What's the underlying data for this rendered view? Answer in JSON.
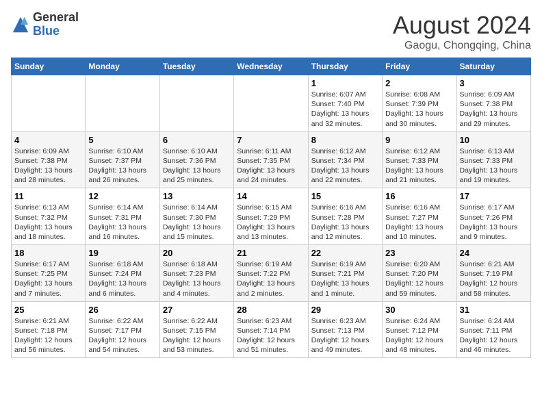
{
  "logo": {
    "general": "General",
    "blue": "Blue"
  },
  "title": {
    "month_year": "August 2024",
    "location": "Gaogu, Chongqing, China"
  },
  "weekdays": [
    "Sunday",
    "Monday",
    "Tuesday",
    "Wednesday",
    "Thursday",
    "Friday",
    "Saturday"
  ],
  "weeks": [
    [
      {
        "day": "",
        "info": ""
      },
      {
        "day": "",
        "info": ""
      },
      {
        "day": "",
        "info": ""
      },
      {
        "day": "",
        "info": ""
      },
      {
        "day": "1",
        "info": "Sunrise: 6:07 AM\nSunset: 7:40 PM\nDaylight: 13 hours\nand 32 minutes."
      },
      {
        "day": "2",
        "info": "Sunrise: 6:08 AM\nSunset: 7:39 PM\nDaylight: 13 hours\nand 30 minutes."
      },
      {
        "day": "3",
        "info": "Sunrise: 6:09 AM\nSunset: 7:38 PM\nDaylight: 13 hours\nand 29 minutes."
      }
    ],
    [
      {
        "day": "4",
        "info": "Sunrise: 6:09 AM\nSunset: 7:38 PM\nDaylight: 13 hours\nand 28 minutes."
      },
      {
        "day": "5",
        "info": "Sunrise: 6:10 AM\nSunset: 7:37 PM\nDaylight: 13 hours\nand 26 minutes."
      },
      {
        "day": "6",
        "info": "Sunrise: 6:10 AM\nSunset: 7:36 PM\nDaylight: 13 hours\nand 25 minutes."
      },
      {
        "day": "7",
        "info": "Sunrise: 6:11 AM\nSunset: 7:35 PM\nDaylight: 13 hours\nand 24 minutes."
      },
      {
        "day": "8",
        "info": "Sunrise: 6:12 AM\nSunset: 7:34 PM\nDaylight: 13 hours\nand 22 minutes."
      },
      {
        "day": "9",
        "info": "Sunrise: 6:12 AM\nSunset: 7:33 PM\nDaylight: 13 hours\nand 21 minutes."
      },
      {
        "day": "10",
        "info": "Sunrise: 6:13 AM\nSunset: 7:33 PM\nDaylight: 13 hours\nand 19 minutes."
      }
    ],
    [
      {
        "day": "11",
        "info": "Sunrise: 6:13 AM\nSunset: 7:32 PM\nDaylight: 13 hours\nand 18 minutes."
      },
      {
        "day": "12",
        "info": "Sunrise: 6:14 AM\nSunset: 7:31 PM\nDaylight: 13 hours\nand 16 minutes."
      },
      {
        "day": "13",
        "info": "Sunrise: 6:14 AM\nSunset: 7:30 PM\nDaylight: 13 hours\nand 15 minutes."
      },
      {
        "day": "14",
        "info": "Sunrise: 6:15 AM\nSunset: 7:29 PM\nDaylight: 13 hours\nand 13 minutes."
      },
      {
        "day": "15",
        "info": "Sunrise: 6:16 AM\nSunset: 7:28 PM\nDaylight: 13 hours\nand 12 minutes."
      },
      {
        "day": "16",
        "info": "Sunrise: 6:16 AM\nSunset: 7:27 PM\nDaylight: 13 hours\nand 10 minutes."
      },
      {
        "day": "17",
        "info": "Sunrise: 6:17 AM\nSunset: 7:26 PM\nDaylight: 13 hours\nand 9 minutes."
      }
    ],
    [
      {
        "day": "18",
        "info": "Sunrise: 6:17 AM\nSunset: 7:25 PM\nDaylight: 13 hours\nand 7 minutes."
      },
      {
        "day": "19",
        "info": "Sunrise: 6:18 AM\nSunset: 7:24 PM\nDaylight: 13 hours\nand 6 minutes."
      },
      {
        "day": "20",
        "info": "Sunrise: 6:18 AM\nSunset: 7:23 PM\nDaylight: 13 hours\nand 4 minutes."
      },
      {
        "day": "21",
        "info": "Sunrise: 6:19 AM\nSunset: 7:22 PM\nDaylight: 13 hours\nand 2 minutes."
      },
      {
        "day": "22",
        "info": "Sunrise: 6:19 AM\nSunset: 7:21 PM\nDaylight: 13 hours\nand 1 minute."
      },
      {
        "day": "23",
        "info": "Sunrise: 6:20 AM\nSunset: 7:20 PM\nDaylight: 12 hours\nand 59 minutes."
      },
      {
        "day": "24",
        "info": "Sunrise: 6:21 AM\nSunset: 7:19 PM\nDaylight: 12 hours\nand 58 minutes."
      }
    ],
    [
      {
        "day": "25",
        "info": "Sunrise: 6:21 AM\nSunset: 7:18 PM\nDaylight: 12 hours\nand 56 minutes."
      },
      {
        "day": "26",
        "info": "Sunrise: 6:22 AM\nSunset: 7:17 PM\nDaylight: 12 hours\nand 54 minutes."
      },
      {
        "day": "27",
        "info": "Sunrise: 6:22 AM\nSunset: 7:15 PM\nDaylight: 12 hours\nand 53 minutes."
      },
      {
        "day": "28",
        "info": "Sunrise: 6:23 AM\nSunset: 7:14 PM\nDaylight: 12 hours\nand 51 minutes."
      },
      {
        "day": "29",
        "info": "Sunrise: 6:23 AM\nSunset: 7:13 PM\nDaylight: 12 hours\nand 49 minutes."
      },
      {
        "day": "30",
        "info": "Sunrise: 6:24 AM\nSunset: 7:12 PM\nDaylight: 12 hours\nand 48 minutes."
      },
      {
        "day": "31",
        "info": "Sunrise: 6:24 AM\nSunset: 7:11 PM\nDaylight: 12 hours\nand 46 minutes."
      }
    ]
  ]
}
